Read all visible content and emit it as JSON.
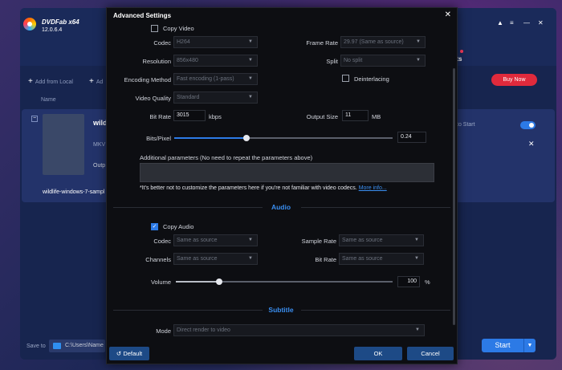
{
  "app": {
    "name": "DVDFab x64",
    "version": "12.0.6.4",
    "add_from_local": "Add from Local",
    "add_short": "Ad",
    "column_name": "Name",
    "file_title": "wild",
    "file_format": "MKV",
    "file_output": "Outp",
    "file_fullname": "wildlife-windows-7-sampl",
    "convert_label": "to Start",
    "products_label": "ucts",
    "buy_now": "Buy Now",
    "save_to": "Save to",
    "save_path": "C:\\Users\\Name",
    "start": "Start"
  },
  "dialog": {
    "title": "Advanced Settings",
    "default_btn": "Default",
    "ok_btn": "OK",
    "cancel_btn": "Cancel",
    "video": {
      "copy_video_label": "Copy Video",
      "codec_label": "Codec",
      "codec_value": "H264",
      "framerate_label": "Frame Rate",
      "framerate_value": "29.97 (Same as source)",
      "resolution_label": "Resolution",
      "resolution_value": "856x480",
      "split_label": "Split",
      "split_value": "No split",
      "encoding_label": "Encoding Method",
      "encoding_value": "Fast encoding (1-pass)",
      "deinterlacing_label": "Deinterlacing",
      "quality_label": "Video Quality",
      "quality_value": "Standard",
      "bitrate_label": "Bit Rate",
      "bitrate_value": "3015",
      "bitrate_unit": "kbps",
      "outputsize_label": "Output Size",
      "outputsize_value": "11",
      "outputsize_unit": "MB",
      "bitspixel_label": "Bits/Pixel",
      "bitspixel_value": "0.24",
      "bitspixel_level": 0.33,
      "additional_label": "Additional parameters (No need to repeat the parameters above)",
      "note": "*It's better not to customize the parameters here if you're not familiar with video codecs.",
      "more_info": "More info..."
    },
    "audio": {
      "title": "Audio",
      "copy_audio_label": "Copy Audio",
      "codec_label": "Codec",
      "codec_value": "Same as source",
      "samplerate_label": "Sample Rate",
      "samplerate_value": "Same as source",
      "channels_label": "Channels",
      "channels_value": "Same as source",
      "bitrate_label": "Bit Rate",
      "bitrate_value": "Same as source",
      "volume_label": "Volume",
      "volume_value": "100",
      "volume_unit": "%",
      "volume_level": 0.2
    },
    "subtitle": {
      "title": "Subtitle",
      "mode_label": "Mode",
      "mode_value": "Direct render to video"
    }
  }
}
